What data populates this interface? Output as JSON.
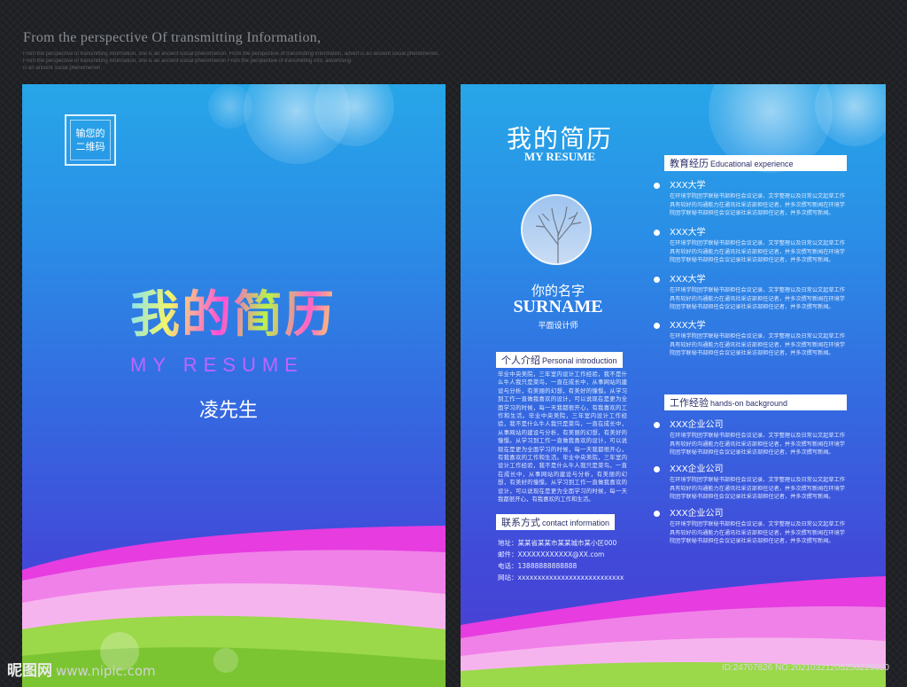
{
  "header": {
    "caption": "From the perspective Of transmitting Information,",
    "small_lines": [
      "From the perspective of transmitting information, she is an ancient social phenomenon. From the perspective of transmitting information, advert is an ancient social phenomenon.",
      "From the perspective of transmitting information, she is an ancient social phenomenon From the perspective of transmitting info, advertising",
      "is an ancient social phenomenon."
    ]
  },
  "cover": {
    "qr_line1": "输您的",
    "qr_line2": "二维码",
    "title": "我的简历",
    "subtitle": "MY RESUME",
    "owner": "凌先生"
  },
  "resume": {
    "title": "我的简历",
    "subtitle": "MY RESUME",
    "name_cn": "你的名字",
    "surname": "SURNAME",
    "job": "平面设计师",
    "intro": {
      "label_cn": "个人介绍",
      "label_en": "Personal introduction",
      "text": "毕业中央美院，三年室内设计工作经验，我不是什么牛人我只是菜鸟，一直在成长中，从事网站的建设与分析，有美丽的幻想，有美好的憧憬。从学习到工作一直做我喜欢的设计，可以说现在是更为全面学习的时候，每一天我都很开心，有我喜欢的工作和生活。毕业中央美院，三年室内设计工作经验，我不是什么牛人我只是菜鸟，一直在成长中，从事网站的建设与分析，有美丽的幻想，有美好的憧憬。从学习到工作一直做我喜欢的设计，可以说现在是更为全面学习的时候，每一天我都很开心，有我喜欢的工作和生活。毕业中央美院，三年室内设计工作经验，我不是什么牛人我只是菜鸟，一直在成长中，从事网站的建设与分析，有美丽的幻想，有美好的憧憬。从学习到工作一直做我喜欢的设计，可以说现在是更为全面学习的时候，每一天我都很开心，有我喜欢的工作和生活。"
    },
    "contact": {
      "label_cn": "联系方式",
      "label_en": "contact information",
      "address": "地址：某某省某某市某某城市某小区000",
      "email": "邮件：XXXXXXXXXXXX@XX.com",
      "phone": "电话：13888888888888",
      "website": "网站：xxxxxxxxxxxxxxxxxxxxxxxxxxx"
    },
    "education": {
      "label_cn": "教育经历",
      "label_en": "Educational experience",
      "items": [
        {
          "title": "XXX大学",
          "lines": [
            "在环境学院团学联秘书部担任会议记录、文字整理以及日常公文起草工作",
            "具有较好的沟通能力在通讯社采访部担任记者，并多次撰写新闻在环境学",
            "院团学联秘书部担任会议记录社采访部担任记者，并多次撰写新闻。"
          ]
        },
        {
          "title": "XXX大学",
          "lines": [
            "在环境学院团学联秘书部担任会议记录、文字整理以及日常公文起草工作",
            "具有较好的沟通能力在通讯社采访部担任记者，并多次撰写新闻在环境学",
            "院团学联秘书部担任会议记录社采访部担任记者，并多次撰写新闻。"
          ]
        },
        {
          "title": "XXX大学",
          "lines": [
            "在环境学院团学联秘书部担任会议记录、文字整理以及日常公文起草工作",
            "具有较好的沟通能力在通讯社采访部担任记者，并多次撰写新闻在环境学",
            "院团学联秘书部担任会议记录社采访部担任记者，并多次撰写新闻。"
          ]
        },
        {
          "title": "XXX大学",
          "lines": [
            "在环境学院团学联秘书部担任会议记录、文字整理以及日常公文起草工作",
            "具有较好的沟通能力在通讯社采访部担任记者，并多次撰写新闻在环境学",
            "院团学联秘书部担任会议记录社采访部担任记者，并多次撰写新闻。"
          ]
        }
      ]
    },
    "work": {
      "label_cn": "工作经验",
      "label_en": "hands-on background",
      "items": [
        {
          "title": "XXX企业公司",
          "lines": [
            "在环境学院团学联秘书部担任会议记录、文字整理以及日常公文起草工作",
            "具有较好的沟通能力在通讯社采访部担任记者，并多次撰写新闻在环境学",
            "院团学联秘书部担任会议记录社采访部担任记者，并多次撰写新闻。"
          ]
        },
        {
          "title": "XXX企业公司",
          "lines": [
            "在环境学院团学联秘书部担任会议记录、文字整理以及日常公文起草工作",
            "具有较好的沟通能力在通讯社采访部担任记者，并多次撰写新闻在环境学",
            "院团学联秘书部担任会议记录社采访部担任记者，并多次撰写新闻。"
          ]
        },
        {
          "title": "XXX企业公司",
          "lines": [
            "在环境学院团学联秘书部担任会议记录、文字整理以及日常公文起草工作",
            "具有较好的沟通能力在通讯社采访部担任记者，并多次撰写新闻在环境学",
            "院团学联秘书部担任会议记录社采访部担任记者，并多次撰写新闻。"
          ]
        }
      ]
    }
  },
  "watermark": {
    "logo": "昵图网",
    "url": "www.nipic.com",
    "id": "ID:24707826 NO:20210321205250229000"
  },
  "colors": {
    "page_top": "#27a6e8",
    "page_bottom": "#4a3fd2",
    "magenta_wave": "#e63ce0",
    "green_wave": "#8fd33a"
  }
}
